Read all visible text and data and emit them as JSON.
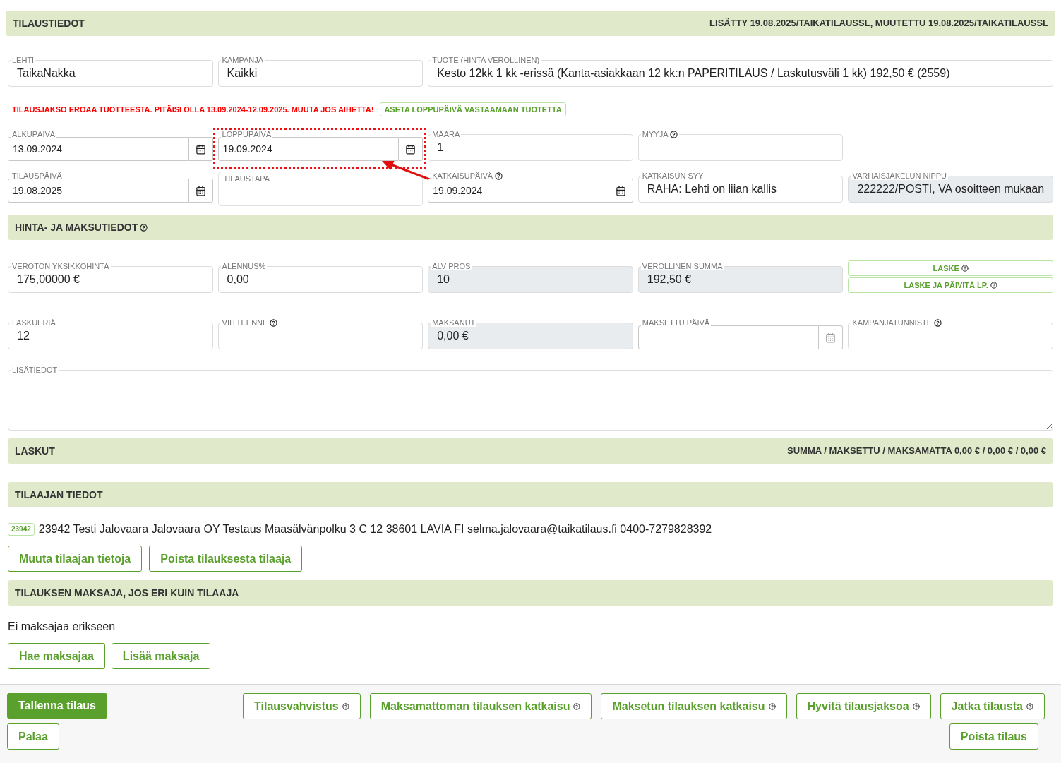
{
  "order_header": {
    "title": "TILAUSTIEDOT",
    "meta": "LISÄTTY 19.08.2025/TAIKATILAUSSL, MUUTETTU 19.08.2025/TAIKATILAUSSL"
  },
  "product_row": [
    {
      "kind": "text",
      "label": "LEHTI",
      "value": "TaikaNakka"
    },
    {
      "kind": "text",
      "label": "KAMPANJA",
      "value": "Kaikki"
    },
    {
      "kind": "wide",
      "label": "TUOTE (HINTA VEROLLINEN)",
      "value": "Kesto 12kk 1 kk -erissä (Kanta-asiakkaan 12 kk:n PAPERITILAUS / Laskutusväli 1 kk) 192,50 € (2559)"
    }
  ],
  "warning": {
    "text": "TILAUSJAKSO EROAA TUOTTEESTA. PITÄISI OLLA 13.09.2024-12.09.2025. MUUTA JOS AIHETTA!",
    "button": "ASETA LOPPUPÄIVÄ VASTAAMAAN TUOTETTA"
  },
  "period_row": [
    {
      "kind": "date",
      "label": "ALKUPÄIVÄ",
      "value": "13.09.2024",
      "help": false,
      "highlighted": false
    },
    {
      "kind": "date",
      "label": "LOPPUPÄIVÄ",
      "value": "19.09.2024",
      "help": false,
      "highlighted": true
    },
    {
      "kind": "text",
      "label": "MÄÄRÄ",
      "value": "1",
      "help": false
    },
    {
      "kind": "text",
      "label": "MYYJÄ",
      "help": true
    },
    {
      "kind": "gap"
    }
  ],
  "order_row": [
    {
      "kind": "date",
      "label": "TILAUSPÄIVÄ",
      "value": "19.08.2025",
      "help": false,
      "highlighted": false
    },
    {
      "kind": "select",
      "label": "TILAUSTAPA"
    },
    {
      "kind": "date",
      "label": "KATKAISUPÄIVÄ",
      "value": "19.09.2024",
      "help": true,
      "highlighted": false
    },
    {
      "kind": "text",
      "label": "KATKAISUN SYY",
      "value": "RAHA: Lehti on liian kallis",
      "help": false
    },
    {
      "kind": "readonly",
      "label": "VARHAISJAKELUN NIPPU",
      "value": "222222/POSTI, VA osoitteen mukaan",
      "help": false
    }
  ],
  "price_header": {
    "title": "HINTA- JA MAKSUTIEDOT",
    "help": true
  },
  "price_row": [
    {
      "kind": "text",
      "label": "VEROTON YKSIKKÖHINTA",
      "value": "175,00000 €",
      "help": false
    },
    {
      "kind": "text",
      "label": "ALENNUS%",
      "value": "0,00",
      "help": false
    },
    {
      "kind": "readonly",
      "label": "ALV PROS",
      "value": "10",
      "help": false
    },
    {
      "kind": "readonly",
      "label": "VEROLLINEN SUMMA",
      "value": "192,50 €",
      "help": false
    },
    {
      "kind": "buttons",
      "buttons": [
        "LASKE",
        "LASKE JA PÄIVITÄ LP."
      ]
    }
  ],
  "payment_row": [
    {
      "kind": "text",
      "label": "LASKUERIÄ",
      "value": "12",
      "help": false
    },
    {
      "kind": "text",
      "label": "VIITTEENNE",
      "help": true
    },
    {
      "kind": "readonly",
      "label": "MAKSANUT",
      "value": "0,00 €",
      "help": false
    },
    {
      "kind": "date",
      "label": "MAKSETTU PÄIVÄ",
      "help": false,
      "highlighted": false,
      "disabled": true
    },
    {
      "kind": "text",
      "label": "KAMPANJATUNNISTE",
      "help": true
    }
  ],
  "notes": {
    "label": "LISÄTIEDOT"
  },
  "invoices_header": {
    "title": "LASKUT",
    "meta": "SUMMA / MAKSETTU / MAKSAMATTA 0,00 € / 0,00 € / 0,00 €"
  },
  "subscriber": {
    "title": "TILAAJAN TIEDOT",
    "badge": "23942",
    "details": "23942 Testi Jalovaara Jalovaara OY Testaus Maasälvänpolku 3 C 12 38601 LAVIA FI selma.jalovaara@taikatilaus.fi 0400-7279828392",
    "buttons": [
      "Muuta tilaajan tietoja",
      "Poista tilauksesta tilaaja"
    ]
  },
  "payer": {
    "title": "TILAUKSEN MAKSAJA, JOS ERI KUIN TILAAJA",
    "text": "Ei maksajaa erikseen",
    "buttons": [
      "Hae maksajaa",
      "Lisää maksaja"
    ]
  },
  "footer": {
    "save": "Tallenna tilaus",
    "back": "Palaa",
    "actions": [
      "Tilausvahvistus",
      "Maksamattoman tilauksen katkaisu",
      "Maksetun tilauksen katkaisu",
      "Hyvitä tilausjaksoa",
      "Jatka tilausta"
    ],
    "delete": "Poista tilaus"
  }
}
